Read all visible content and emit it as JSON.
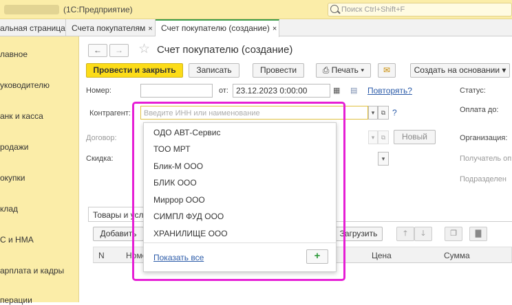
{
  "window": {
    "app_title": "(1С:Предприятие)",
    "search_placeholder": "Поиск Ctrl+Shift+F"
  },
  "tabs": [
    {
      "label": "альная страница"
    },
    {
      "label": "Счета покупателям",
      "close": "×"
    },
    {
      "label": "Счет покупателю (создание)",
      "close": "×"
    }
  ],
  "sidebar": {
    "items": [
      "лавное",
      "уководителю",
      "анк и касса",
      "родажи",
      "окупки",
      "клад",
      "С и НМА",
      "арплата и кадры",
      "перации"
    ]
  },
  "form": {
    "title": "Счет покупателю (создание)",
    "nav_back": "←",
    "nav_forward": "→",
    "buttons": {
      "post_close": "Провести и закрыть",
      "save": "Записать",
      "post": "Провести",
      "print": "Печать",
      "create_based": "Создать на основании"
    },
    "number_label": "Номер:",
    "date_from_label": "от:",
    "date_value": "23.12.2023  0:00:00",
    "repeat_link": "Повторять?",
    "status_label": "Статус:",
    "contractor_label": "Контрагент:",
    "contractor_placeholder": "Введите ИНН или наименование",
    "help": "?",
    "payment_until_label": "Оплата до:",
    "contract_label": "Договор:",
    "new_button": "Новый",
    "organization_label": "Организация:",
    "discount_label": "Скидка:",
    "recipient_label": "Получатель оп",
    "department_label": "Подразделен",
    "goods_tab": "Товары и услуги",
    "add_button": "Добавить",
    "load_button": "Загрузить",
    "grid": {
      "col_n": "N",
      "col_nom": "Номенклатура",
      "col_price": "Цена",
      "col_sum": "Сумма"
    }
  },
  "dropdown": {
    "items": [
      "ОДО АВТ-Сервис",
      "ТОО МРТ",
      "Блик-М ООО",
      "БЛИК ООО",
      "Миррор ООО",
      "СИМПЛ ФУД ООО",
      "ХРАНИЛИЩЕ ООО"
    ],
    "show_all": "Показать все",
    "add": "+"
  },
  "colors": {
    "sidebar": "#fbeda8",
    "primary_button": "#fcdc18",
    "highlight": "#e61ed5",
    "link": "#2a5aa8"
  }
}
